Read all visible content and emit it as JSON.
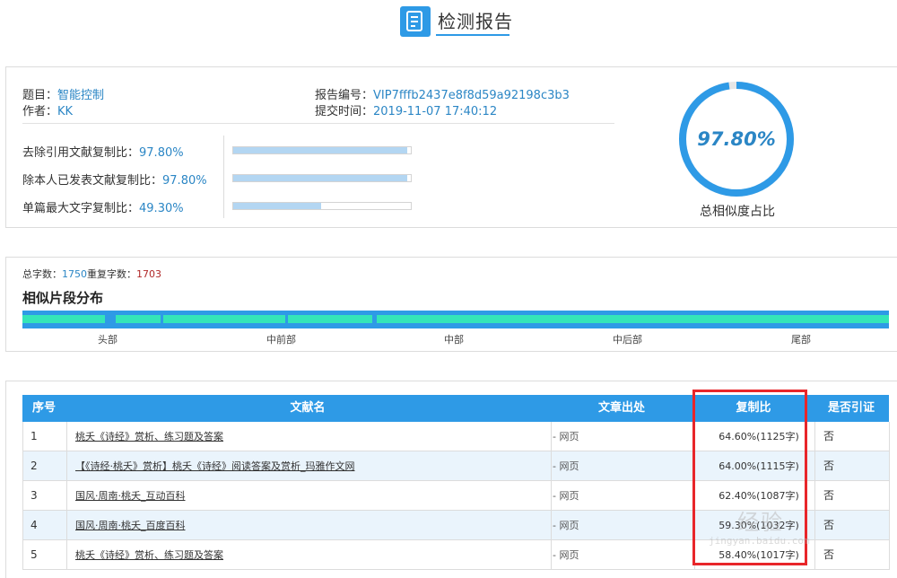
{
  "header": {
    "title": "检测报告",
    "icon": "document-icon",
    "accent": "#2e9ae6"
  },
  "meta": {
    "title_label": "题目：",
    "title_value": "智能控制",
    "author_label": "作者：",
    "author_value": "KK",
    "report_no_label": "报告编号：",
    "report_no_value": "VIP7fffb2437e8f8d59a92198c3b3",
    "submit_time_label": "提交时间：",
    "submit_time_value": "2019-11-07 17:40:12"
  },
  "stats": [
    {
      "label": "去除引用文献复制比：",
      "value": "97.80%",
      "fraction": 0.978
    },
    {
      "label": "除本人已发表文献复制比：",
      "value": "97.80%",
      "fraction": 0.978
    },
    {
      "label": "单篇最大文字复制比：",
      "value": "49.30%",
      "fraction": 0.493
    }
  ],
  "similarity": {
    "value": "97.80%",
    "fraction": 0.978,
    "label": "总相似度占比"
  },
  "counts": {
    "total_label": "总字数：",
    "total_value": "1750",
    "repeat_label": "重复字数：",
    "repeat_value": "1703"
  },
  "distribution": {
    "title": "相似片段分布",
    "labels": [
      "头部",
      "中前部",
      "中部",
      "中后部",
      "尾部"
    ]
  },
  "table": {
    "headers": [
      "序号",
      "文献名",
      "文章出处",
      "复制比",
      "是否引证"
    ],
    "rows": [
      {
        "idx": "1",
        "name": "桃夭《诗经》赏析、练习题及答案",
        "source": "- 网页",
        "ratio": "64.60%(1125字)",
        "cite": "否"
      },
      {
        "idx": "2",
        "name": "【《诗经·桃夭》赏析】桃夭《诗经》阅读答案及赏析_玛雅作文网",
        "source": "- 网页",
        "ratio": "64.00%(1115字)",
        "cite": "否"
      },
      {
        "idx": "3",
        "name": "国风·周南·桃夭_互动百科",
        "source": "- 网页",
        "ratio": "62.40%(1087字)",
        "cite": "否"
      },
      {
        "idx": "4",
        "name": "国风·周南·桃夭_百度百科",
        "source": "- 网页",
        "ratio": "59.30%(1032字)",
        "cite": "否"
      },
      {
        "idx": "5",
        "name": "桃夭《诗经》赏析、练习题及答案",
        "source": "- 网页",
        "ratio": "58.40%(1017字)",
        "cite": "否"
      }
    ]
  },
  "watermark": {
    "text": "经验",
    "sub": "jingyan.baidu.com"
  },
  "colors": {
    "highlight": "#e8262a",
    "segment": "#34e5b8",
    "bar_fill": "#b3d6f2"
  }
}
